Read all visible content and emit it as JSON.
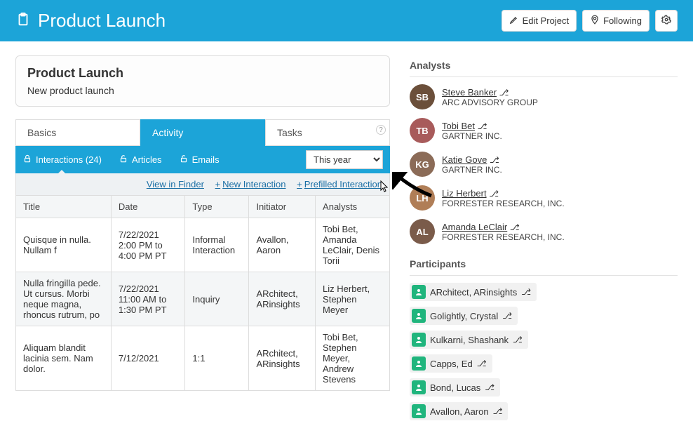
{
  "header": {
    "title": "Product Launch",
    "edit_label": "Edit Project",
    "follow_label": "Following"
  },
  "card": {
    "title": "Product Launch",
    "subtitle": "New product launch"
  },
  "tabs": {
    "basics": "Basics",
    "activity": "Activity",
    "tasks": "Tasks"
  },
  "subtabs": {
    "interactions": "Interactions (24)",
    "articles": "Articles",
    "emails": "Emails",
    "year_selected": "This year"
  },
  "actions": {
    "view_in_finder": "View in Finder",
    "new_interaction": "New Interaction",
    "prefilled_interaction": "Prefilled Interaction"
  },
  "table": {
    "headers": {
      "title": "Title",
      "date": "Date",
      "type": "Type",
      "initiator": "Initiator",
      "analysts": "Analysts"
    },
    "rows": [
      {
        "title": "Quisque in nulla. Nullam f",
        "date": "7/22/2021 2:00 PM to 4:00 PM PT",
        "type": "Informal Interaction",
        "initiator": "Avallon, Aaron",
        "analysts": "Tobi Bet, Amanda LeClair, Denis Torii"
      },
      {
        "title": "Nulla fringilla pede. Ut cursus. Morbi neque magna, rhoncus rutrum, po",
        "date": "7/22/2021 11:00 AM to 1:30 PM PT",
        "type": "Inquiry",
        "initiator": "ARchitect, ARinsights",
        "analysts": "Liz Herbert, Stephen Meyer"
      },
      {
        "title": "Aliquam blandit lacinia sem. Nam dolor.",
        "date": "7/12/2021",
        "type": "1:1",
        "initiator": "ARchitect, ARinsights",
        "analysts": "Tobi Bet, Stephen Meyer, Andrew Stevens"
      }
    ]
  },
  "analysts_heading": "Analysts",
  "analysts": [
    {
      "name": "Steve Banker",
      "org": "ARC ADVISORY GROUP"
    },
    {
      "name": "Tobi Bet",
      "org": "GARTNER INC."
    },
    {
      "name": "Katie Gove",
      "org": "GARTNER INC."
    },
    {
      "name": "Liz Herbert",
      "org": "FORRESTER RESEARCH, INC."
    },
    {
      "name": "Amanda LeClair",
      "org": "FORRESTER RESEARCH, INC."
    }
  ],
  "participants_heading": "Participants",
  "participants": [
    "ARchitect, ARinsights",
    "Golightly, Crystal",
    "Kulkarni, Shashank",
    "Capps, Ed",
    "Bond, Lucas",
    "Avallon, Aaron"
  ]
}
